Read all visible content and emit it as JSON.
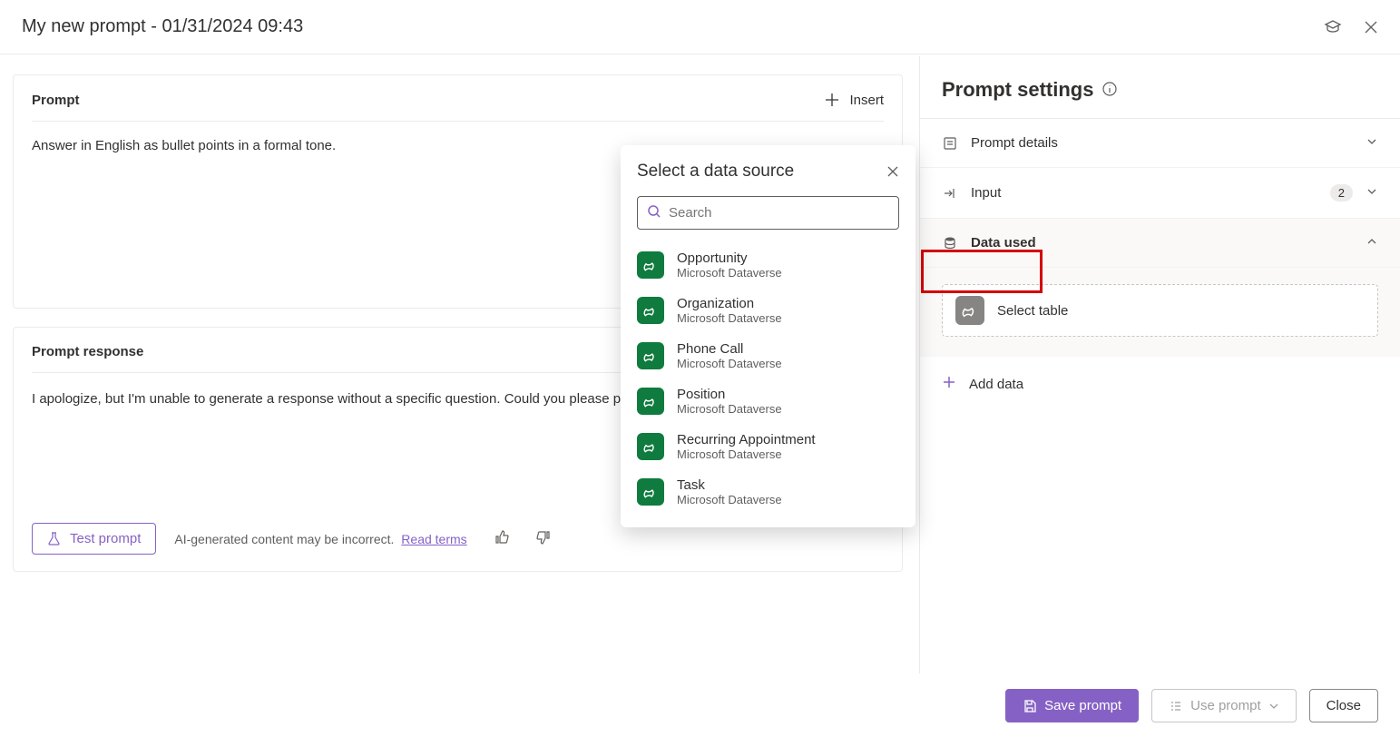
{
  "header": {
    "title": "My new prompt - 01/31/2024 09:43"
  },
  "prompt": {
    "section_title": "Prompt",
    "insert_label": "Insert",
    "text": "Answer in English as bullet points in a formal tone."
  },
  "response": {
    "section_title": "Prompt response",
    "text": "I apologize, but I'm unable to generate a response without a specific question. Could you please provide",
    "test_label": "Test prompt",
    "disclaimer": "AI-generated content may be incorrect.",
    "terms": "Read terms"
  },
  "settings": {
    "title": "Prompt settings",
    "details_label": "Prompt details",
    "input_label": "Input",
    "input_count": "2",
    "data_used_label": "Data used",
    "select_table_label": "Select table",
    "add_data_label": "Add data"
  },
  "footer": {
    "save": "Save prompt",
    "use": "Use prompt",
    "close": "Close"
  },
  "popover": {
    "title": "Select a data source",
    "search_placeholder": "Search",
    "items": [
      {
        "name": "Opportunity",
        "source": "Microsoft Dataverse"
      },
      {
        "name": "Organization",
        "source": "Microsoft Dataverse"
      },
      {
        "name": "Phone Call",
        "source": "Microsoft Dataverse"
      },
      {
        "name": "Position",
        "source": "Microsoft Dataverse"
      },
      {
        "name": "Recurring Appointment",
        "source": "Microsoft Dataverse"
      },
      {
        "name": "Task",
        "source": "Microsoft Dataverse"
      }
    ]
  }
}
